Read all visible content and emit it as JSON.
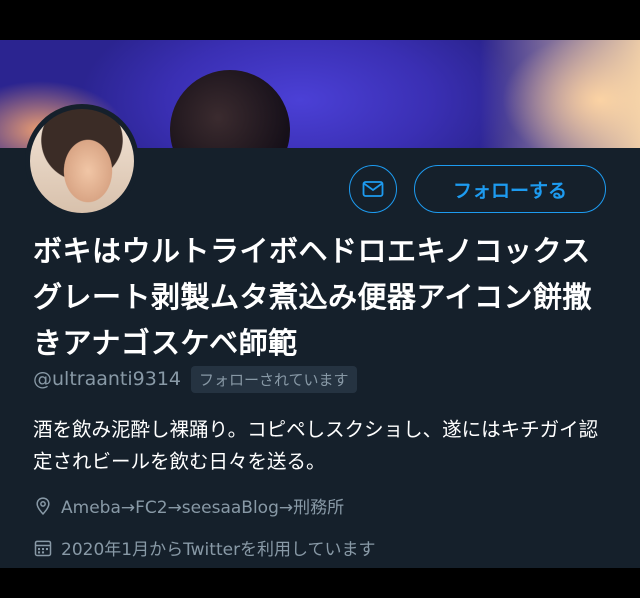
{
  "profile": {
    "display_name": "ボキはウルトライボヘドロエキノコックスグレート剥製ムタ煮込み便器アイコン餅撒きアナゴスケベ師範",
    "handle": "@ultraanti9314",
    "follows_you_badge": "フォローされています",
    "bio": "酒を飲み泥酔し裸踊り。コピペしスクショし、遂にはキチガイ認定されビールを飲む日々を送る。",
    "location": "Ameba→FC2→seesaaBlog→刑務所",
    "joined": "2020年1月からTwitterを利用しています"
  },
  "actions": {
    "follow_label": "フォローする",
    "message_icon": "mail-icon"
  },
  "icons": {
    "location": "location-pin-icon",
    "joined": "calendar-icon"
  },
  "colors": {
    "background": "#15202b",
    "accent": "#1d9bf0",
    "secondary_text": "#8899a6",
    "badge_bg": "#253341"
  }
}
